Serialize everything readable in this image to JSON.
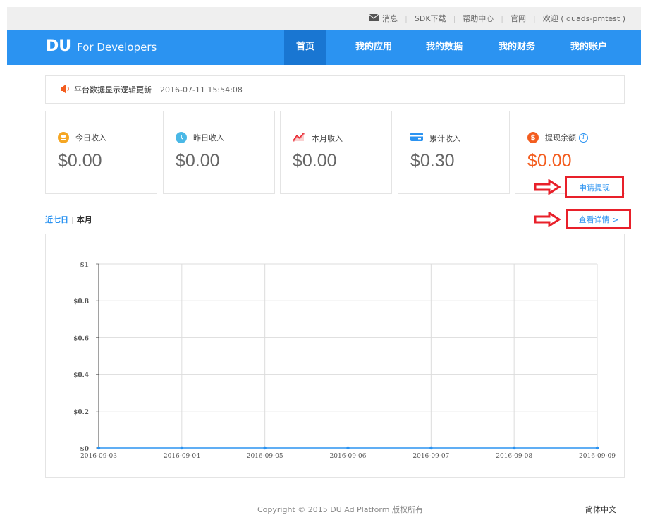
{
  "topbar": {
    "messages": "消息",
    "sdk": "SDK下载",
    "help": "帮助中心",
    "official": "官网",
    "welcome": "欢迎 ( duads-pmtest )"
  },
  "header": {
    "logo": "DU",
    "logo_sub": "For Developers",
    "nav": [
      {
        "label": "首页",
        "active": true
      },
      {
        "label": "我的应用"
      },
      {
        "label": "我的数据"
      },
      {
        "label": "我的财务"
      },
      {
        "label": "我的账户"
      }
    ]
  },
  "notice": {
    "text": "平台数据显示逻辑更新",
    "time": "2016-07-11 15:54:08"
  },
  "cards": [
    {
      "label": "今日收入",
      "value": "$0.00",
      "icon": "coin-stack-icon"
    },
    {
      "label": "昨日收入",
      "value": "$0.00",
      "icon": "clock-icon"
    },
    {
      "label": "本月收入",
      "value": "$0.00",
      "icon": "trend-icon"
    },
    {
      "label": "累计收入",
      "value": "$0.30",
      "icon": "card-icon"
    },
    {
      "label": "提现余额",
      "value": "$0.00",
      "icon": "dollar-icon"
    }
  ],
  "withdraw": "申请提现",
  "details": "查看详情 >",
  "period": {
    "tab1": "近七日",
    "sep": "|",
    "tab2": "本月"
  },
  "colors": {
    "nav": "#2b93f1",
    "nav_active": "#1976d2",
    "accent": "#2b93f1",
    "balance": "#f35d1f",
    "highlight": "#e8202a"
  },
  "chart_data": {
    "type": "line",
    "x": [
      "2016-09-03",
      "2016-09-04",
      "2016-09-05",
      "2016-09-06",
      "2016-09-07",
      "2016-09-08",
      "2016-09-09"
    ],
    "series": [
      {
        "values": [
          0,
          0,
          0,
          0,
          0,
          0,
          0
        ]
      }
    ],
    "yticks": [
      "$0",
      "$0.2",
      "$0.4",
      "$0.6",
      "$0.8",
      "$1"
    ],
    "ylim": [
      0,
      1
    ],
    "grid": true
  },
  "footer": {
    "copyright": "Copyright © 2015 DU Ad Platform 版权所有",
    "lang": "简体中文"
  }
}
